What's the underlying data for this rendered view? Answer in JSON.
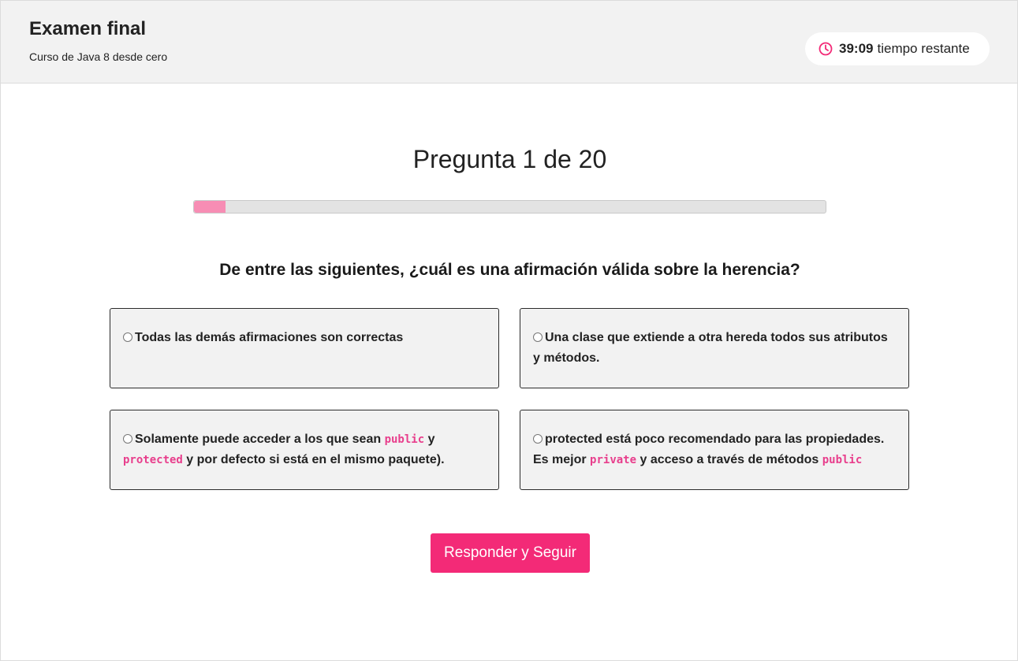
{
  "header": {
    "title": "Examen final",
    "course": "Curso de Java 8 desde cero",
    "timer": {
      "value": "39:09",
      "label": "tiempo restante",
      "icon": "clock-icon",
      "icon_color": "#f32a77"
    }
  },
  "quiz": {
    "counter": "Pregunta 1 de 20",
    "current": 1,
    "total": 20,
    "progress_fraction": 0.05,
    "question": "De entre las siguientes, ¿cuál es una afirmación válida sobre la herencia?",
    "options": [
      {
        "parts": [
          "Todas las demás afirmaciones son correctas"
        ]
      },
      {
        "parts": [
          "Una clase que extiende a otra hereda todos sus atributos y métodos."
        ]
      },
      {
        "parts": [
          "Solamente puede acceder a los que sean ",
          "public",
          " y ",
          "protected",
          " y por defecto si está en el mismo paquete)."
        ]
      },
      {
        "parts": [
          "protected está poco recomendado para las propiedades. Es mejor ",
          "private",
          " y acceso a través de métodos ",
          "public"
        ]
      }
    ],
    "submit_label": "Responder y Seguir"
  },
  "colors": {
    "accent": "#f32a77",
    "progress_fill": "#f78db4",
    "code_text": "#e83e8c",
    "header_bg": "#f2f2f2",
    "option_bg": "#f2f2f2"
  }
}
